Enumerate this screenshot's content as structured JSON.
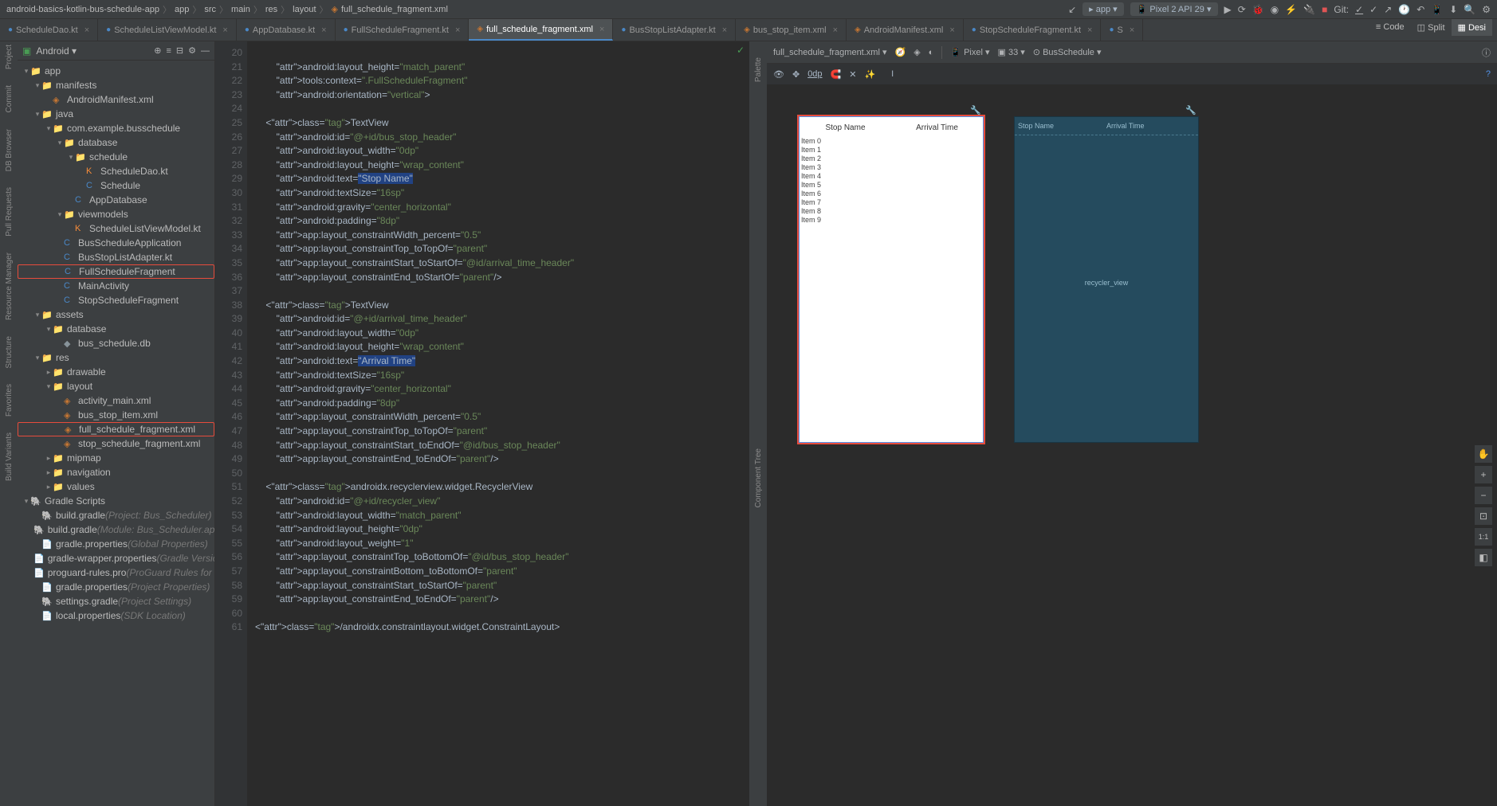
{
  "breadcrumb": [
    "android-basics-kotlin-bus-schedule-app",
    "app",
    "src",
    "main",
    "res",
    "layout",
    "full_schedule_fragment.xml"
  ],
  "runConfig": "app",
  "device": "Pixel 2 API 29",
  "gitLabel": "Git:",
  "viewModes": {
    "code": "Code",
    "split": "Split",
    "design": "Desi"
  },
  "tabs": [
    {
      "name": "ScheduleDao.kt",
      "active": false
    },
    {
      "name": "ScheduleListViewModel.kt",
      "active": false
    },
    {
      "name": "AppDatabase.kt",
      "active": false
    },
    {
      "name": "FullScheduleFragment.kt",
      "active": false
    },
    {
      "name": "full_schedule_fragment.xml",
      "active": true
    },
    {
      "name": "BusStopListAdapter.kt",
      "active": false
    },
    {
      "name": "bus_stop_item.xml",
      "active": false
    },
    {
      "name": "AndroidManifest.xml",
      "active": false
    },
    {
      "name": "StopScheduleFragment.kt",
      "active": false
    },
    {
      "name": "S",
      "active": false
    }
  ],
  "sideTools": [
    "Project",
    "Commit",
    "DB Browser",
    "Pull Requests",
    "Resource Manager",
    "Structure",
    "Favorites",
    "Build Variants"
  ],
  "projectPane": {
    "title": "Android"
  },
  "tree": [
    {
      "d": 0,
      "chev": "▾",
      "icon": "📁",
      "cls": "folder-icon",
      "label": "app"
    },
    {
      "d": 1,
      "chev": "▾",
      "icon": "📁",
      "cls": "folder-icon",
      "label": "manifests"
    },
    {
      "d": 2,
      "chev": "",
      "icon": "◈",
      "cls": "xml-icon",
      "label": "AndroidManifest.xml"
    },
    {
      "d": 1,
      "chev": "▾",
      "icon": "📁",
      "cls": "folder-icon",
      "label": "java"
    },
    {
      "d": 2,
      "chev": "▾",
      "icon": "📁",
      "cls": "folder-icon",
      "label": "com.example.busschedule"
    },
    {
      "d": 3,
      "chev": "▾",
      "icon": "📁",
      "cls": "folder-icon",
      "label": "database"
    },
    {
      "d": 4,
      "chev": "▾",
      "icon": "📁",
      "cls": "folder-icon",
      "label": "schedule"
    },
    {
      "d": 5,
      "chev": "",
      "icon": "K",
      "cls": "kt-icon",
      "label": "ScheduleDao.kt"
    },
    {
      "d": 5,
      "chev": "",
      "icon": "C",
      "cls": "cls-icon",
      "label": "Schedule"
    },
    {
      "d": 4,
      "chev": "",
      "icon": "C",
      "cls": "cls-icon",
      "label": "AppDatabase"
    },
    {
      "d": 3,
      "chev": "▾",
      "icon": "📁",
      "cls": "folder-icon",
      "label": "viewmodels"
    },
    {
      "d": 4,
      "chev": "",
      "icon": "K",
      "cls": "kt-icon",
      "label": "ScheduleListViewModel.kt"
    },
    {
      "d": 3,
      "chev": "",
      "icon": "C",
      "cls": "cls-icon",
      "label": "BusScheduleApplication"
    },
    {
      "d": 3,
      "chev": "",
      "icon": "C",
      "cls": "cls-icon",
      "label": "BusStopListAdapter.kt"
    },
    {
      "d": 3,
      "chev": "",
      "icon": "C",
      "cls": "cls-icon",
      "label": "FullScheduleFragment",
      "red": true
    },
    {
      "d": 3,
      "chev": "",
      "icon": "C",
      "cls": "cls-icon",
      "label": "MainActivity"
    },
    {
      "d": 3,
      "chev": "",
      "icon": "C",
      "cls": "cls-icon",
      "label": "StopScheduleFragment"
    },
    {
      "d": 1,
      "chev": "▾",
      "icon": "📁",
      "cls": "folder-icon",
      "label": "assets"
    },
    {
      "d": 2,
      "chev": "▾",
      "icon": "📁",
      "cls": "folder-icon",
      "label": "database"
    },
    {
      "d": 3,
      "chev": "",
      "icon": "◆",
      "cls": "folder-icon",
      "label": "bus_schedule.db"
    },
    {
      "d": 1,
      "chev": "▾",
      "icon": "📁",
      "cls": "folder-icon",
      "label": "res"
    },
    {
      "d": 2,
      "chev": "▸",
      "icon": "📁",
      "cls": "folder-icon",
      "label": "drawable"
    },
    {
      "d": 2,
      "chev": "▾",
      "icon": "📁",
      "cls": "folder-icon",
      "label": "layout"
    },
    {
      "d": 3,
      "chev": "",
      "icon": "◈",
      "cls": "xml-icon",
      "label": "activity_main.xml"
    },
    {
      "d": 3,
      "chev": "",
      "icon": "◈",
      "cls": "xml-icon",
      "label": "bus_stop_item.xml"
    },
    {
      "d": 3,
      "chev": "",
      "icon": "◈",
      "cls": "xml-icon",
      "label": "full_schedule_fragment.xml",
      "red": true
    },
    {
      "d": 3,
      "chev": "",
      "icon": "◈",
      "cls": "xml-icon",
      "label": "stop_schedule_fragment.xml"
    },
    {
      "d": 2,
      "chev": "▸",
      "icon": "📁",
      "cls": "folder-icon",
      "label": "mipmap"
    },
    {
      "d": 2,
      "chev": "▸",
      "icon": "📁",
      "cls": "folder-icon",
      "label": "navigation"
    },
    {
      "d": 2,
      "chev": "▸",
      "icon": "📁",
      "cls": "folder-icon",
      "label": "values"
    },
    {
      "d": 0,
      "chev": "▾",
      "icon": "🐘",
      "cls": "folder-icon",
      "label": "Gradle Scripts"
    },
    {
      "d": 1,
      "chev": "",
      "icon": "🐘",
      "cls": "folder-icon",
      "label": "build.gradle",
      "dim": "(Project: Bus_Scheduler)"
    },
    {
      "d": 1,
      "chev": "",
      "icon": "🐘",
      "cls": "folder-icon",
      "label": "build.gradle",
      "dim": "(Module: Bus_Scheduler.app)"
    },
    {
      "d": 1,
      "chev": "",
      "icon": "📄",
      "cls": "xml-icon",
      "label": "gradle.properties",
      "dim": "(Global Properties)"
    },
    {
      "d": 1,
      "chev": "",
      "icon": "📄",
      "cls": "xml-icon",
      "label": "gradle-wrapper.properties",
      "dim": "(Gradle Version)"
    },
    {
      "d": 1,
      "chev": "",
      "icon": "📄",
      "cls": "folder-icon",
      "label": "proguard-rules.pro",
      "dim": "(ProGuard Rules for Bu)"
    },
    {
      "d": 1,
      "chev": "",
      "icon": "📄",
      "cls": "xml-icon",
      "label": "gradle.properties",
      "dim": "(Project Properties)"
    },
    {
      "d": 1,
      "chev": "",
      "icon": "🐘",
      "cls": "folder-icon",
      "label": "settings.gradle",
      "dim": "(Project Settings)"
    },
    {
      "d": 1,
      "chev": "",
      "icon": "📄",
      "cls": "xml-icon",
      "label": "local.properties",
      "dim": "(SDK Location)"
    }
  ],
  "code": {
    "startLine": 20,
    "lines": [
      "",
      "        android:layout_height=\"match_parent\"",
      "        tools:context=\".FullScheduleFragment\"",
      "        android:orientation=\"vertical\">",
      "",
      "    <TextView",
      "        android:id=\"@+id/bus_stop_header\"",
      "        android:layout_width=\"0dp\"",
      "        android:layout_height=\"wrap_content\"",
      "        android:text=\"Stop Name\"|HL",
      "        android:textSize=\"16sp\"",
      "        android:gravity=\"center_horizontal\"",
      "        android:padding=\"8dp\"",
      "        app:layout_constraintWidth_percent=\"0.5\"",
      "        app:layout_constraintTop_toTopOf=\"parent\"",
      "        app:layout_constraintStart_toStartOf=\"@id/arrival_time_header\"",
      "        app:layout_constraintEnd_toStartOf=\"parent\"/>",
      "",
      "    <TextView",
      "        android:id=\"@+id/arrival_time_header\"",
      "        android:layout_width=\"0dp\"",
      "        android:layout_height=\"wrap_content\"",
      "        android:text=\"Arrival Time\"|HL",
      "        android:textSize=\"16sp\"",
      "        android:gravity=\"center_horizontal\"",
      "        android:padding=\"8dp\"",
      "        app:layout_constraintWidth_percent=\"0.5\"",
      "        app:layout_constraintTop_toTopOf=\"parent\"",
      "        app:layout_constraintStart_toEndOf=\"@id/bus_stop_header\"",
      "        app:layout_constraintEnd_toEndOf=\"parent\"/>",
      "",
      "    <androidx.recyclerview.widget.RecyclerView",
      "        android:id=\"@+id/recycler_view\"",
      "        android:layout_width=\"match_parent\"",
      "        android:layout_height=\"0dp\"",
      "        android:layout_weight=\"1\"",
      "        app:layout_constraintTop_toBottomOf=\"@id/bus_stop_header\"",
      "        app:layout_constraintBottom_toBottomOf=\"parent\"",
      "        app:layout_constraintStart_toStartOf=\"parent\"",
      "        app:layout_constraintEnd_toEndOf=\"parent\"/>",
      "",
      "</androidx.constraintlayout.widget.ConstraintLayout>"
    ]
  },
  "design": {
    "fileSel": "full_schedule_fragment.xml",
    "deviceSel": "Pixel",
    "api": "33",
    "theme": "BusSchedule",
    "dp": "0dp",
    "hdr1": "Stop Name",
    "hdr2": "Arrival Time",
    "items": [
      "Item 0",
      "Item 1",
      "Item 2",
      "Item 3",
      "Item 4",
      "Item 5",
      "Item 6",
      "Item 7",
      "Item 8",
      "Item 9"
    ],
    "recycler": "recycler_view",
    "zoomRatio": "1:1"
  },
  "designSideTools": [
    "Palette",
    "Component Tree"
  ]
}
